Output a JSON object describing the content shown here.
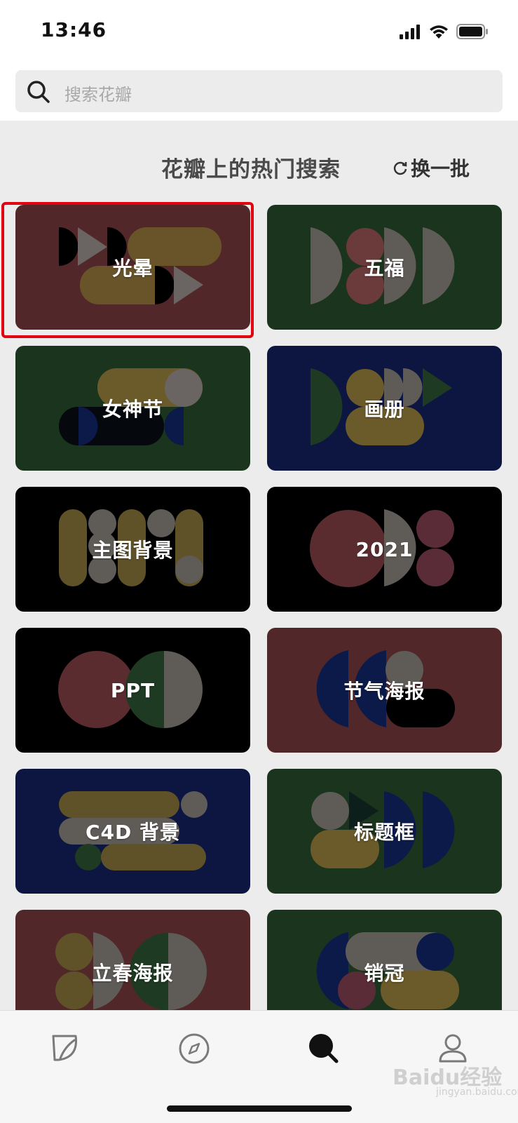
{
  "status": {
    "time": "13:46"
  },
  "search": {
    "placeholder": "搜索花瓣"
  },
  "section": {
    "title": "花瓣上的热门搜索",
    "refresh_label": "换一批"
  },
  "colors": {
    "maroon": "#512729",
    "green": "#1b341d",
    "navy": "#0c1640",
    "black": "#000000",
    "highlight": "#e00010"
  },
  "tiles": [
    {
      "label": "光晕",
      "bg": "maroon"
    },
    {
      "label": "五福",
      "bg": "green"
    },
    {
      "label": "女神节",
      "bg": "green"
    },
    {
      "label": "画册",
      "bg": "navy"
    },
    {
      "label": "主图背景",
      "bg": "black"
    },
    {
      "label": "2021",
      "bg": "black"
    },
    {
      "label": "PPT",
      "bg": "black"
    },
    {
      "label": "节气海报",
      "bg": "maroon"
    },
    {
      "label": "C4D 背景",
      "bg": "navy"
    },
    {
      "label": "标题框",
      "bg": "green"
    },
    {
      "label": "立春海报",
      "bg": "maroon"
    },
    {
      "label": "销冠",
      "bg": "green"
    }
  ],
  "tabbar": {
    "items": [
      "leaf-icon",
      "compass-icon",
      "search-icon",
      "user-icon"
    ],
    "active": "search-icon"
  },
  "watermark": {
    "brand": "Baidu经验",
    "url": "jingyan.baidu.com"
  }
}
